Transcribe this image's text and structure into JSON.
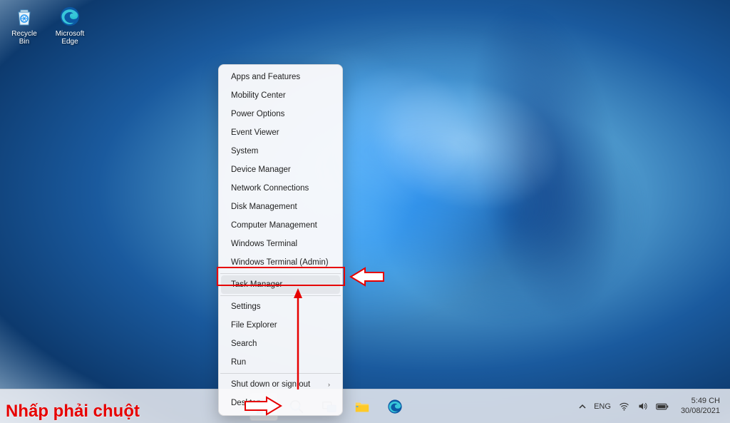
{
  "desktop_icons": [
    {
      "name": "recycle-bin",
      "label": "Recycle Bin"
    },
    {
      "name": "microsoft-edge",
      "label": "Microsoft Edge"
    }
  ],
  "context_menu": {
    "items": [
      {
        "label": "Apps and Features",
        "sep_after": false
      },
      {
        "label": "Mobility Center",
        "sep_after": false
      },
      {
        "label": "Power Options",
        "sep_after": false
      },
      {
        "label": "Event Viewer",
        "sep_after": false
      },
      {
        "label": "System",
        "sep_after": false
      },
      {
        "label": "Device Manager",
        "sep_after": false
      },
      {
        "label": "Network Connections",
        "sep_after": false
      },
      {
        "label": "Disk Management",
        "sep_after": false
      },
      {
        "label": "Computer Management",
        "sep_after": false
      },
      {
        "label": "Windows Terminal",
        "sep_after": false
      },
      {
        "label": "Windows Terminal (Admin)",
        "sep_after": true
      },
      {
        "label": "Task Manager",
        "sep_after": true,
        "highlighted": true
      },
      {
        "label": "Settings",
        "sep_after": false
      },
      {
        "label": "File Explorer",
        "sep_after": false
      },
      {
        "label": "Search",
        "sep_after": false
      },
      {
        "label": "Run",
        "sep_after": true
      },
      {
        "label": "Shut down or sign out",
        "sep_after": false,
        "submenu": true
      },
      {
        "label": "Desktop",
        "sep_after": false
      }
    ]
  },
  "annotation": {
    "text": "Nhấp phải chuột"
  },
  "taskbar": {
    "items": [
      {
        "name": "start-button",
        "active": true
      },
      {
        "name": "search-button"
      },
      {
        "name": "task-view-button"
      },
      {
        "name": "file-explorer-button"
      },
      {
        "name": "edge-button"
      }
    ],
    "tray": {
      "chevron": "⌃",
      "language": "ENG",
      "wifi_icon": "wifi-icon",
      "sound_icon": "sound-icon",
      "battery_icon": "battery-icon"
    },
    "clock": {
      "time": "5:49 CH",
      "date": "30/08/2021"
    }
  }
}
